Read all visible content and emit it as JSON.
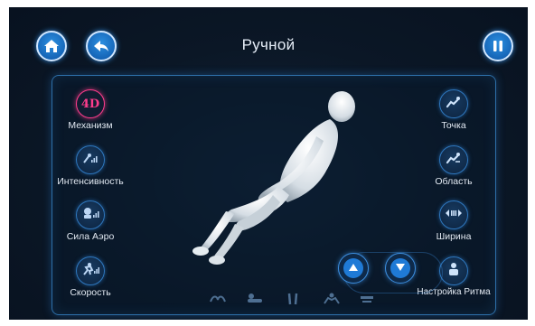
{
  "header": {
    "title": "Ручной",
    "home_icon": "home-icon",
    "back_icon": "back-arrow-icon",
    "pause_icon": "pause-icon"
  },
  "left_modes": [
    {
      "label": "Механизм",
      "badge": "4D",
      "icon": "4d-badge-icon",
      "active": true
    },
    {
      "label": "Интенсивность",
      "icon": "intensity-icon"
    },
    {
      "label": "Сила Аэро",
      "icon": "air-pressure-icon"
    },
    {
      "label": "Скорость",
      "icon": "speed-icon"
    }
  ],
  "right_modes": [
    {
      "label": "Точка",
      "icon": "point-massage-icon"
    },
    {
      "label": "Область",
      "icon": "area-massage-icon"
    },
    {
      "label": "Ширина",
      "icon": "width-icon"
    },
    {
      "label": "Настройка Ритма",
      "icon": "rhythm-settings-icon"
    }
  ],
  "controls": {
    "up_icon": "up-arrow-icon",
    "down_icon": "down-arrow-icon"
  },
  "body_parts": [
    "shoulders-icon",
    "back-icon",
    "legs-icon",
    "arms-icon",
    "seat-icon"
  ],
  "colors": {
    "accent": "#1f7ad6",
    "active": "#ff3d8d",
    "background": "#0b1726",
    "border": "#2d6fa8"
  }
}
